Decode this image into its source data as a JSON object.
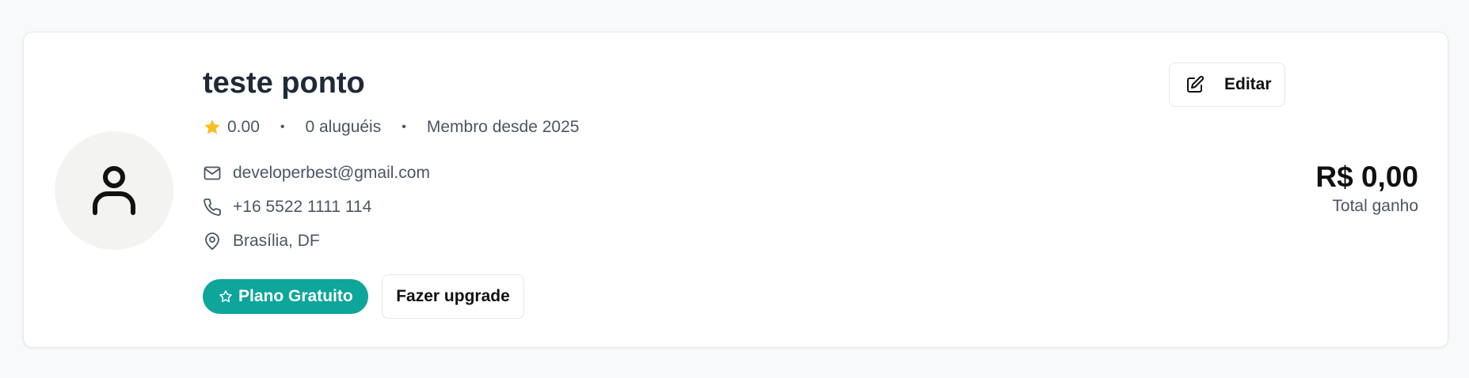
{
  "profile": {
    "name": "teste ponto",
    "rating": "0.00",
    "rentals": "0 aluguéis",
    "member_since": "Membro desde 2025",
    "separator": "•",
    "email": "developerbest@gmail.com",
    "phone": "+16 5522 1111 114",
    "location": "Brasília, DF"
  },
  "plan": {
    "badge_label": "Plano Gratuito",
    "upgrade_label": "Fazer upgrade"
  },
  "actions": {
    "edit_label": "Editar"
  },
  "earnings": {
    "amount": "R$ 0,00",
    "label": "Total ganho"
  },
  "icons": {
    "avatar": "user-icon",
    "rating": "star-icon",
    "email": "mail-icon",
    "phone": "phone-icon",
    "location": "map-pin-icon",
    "plan": "star-outline-icon",
    "edit": "edit-icon"
  },
  "colors": {
    "accent": "#0ea59a",
    "star": "#fbbf24",
    "text_primary": "#1f2937",
    "text_secondary": "#4b5563"
  }
}
